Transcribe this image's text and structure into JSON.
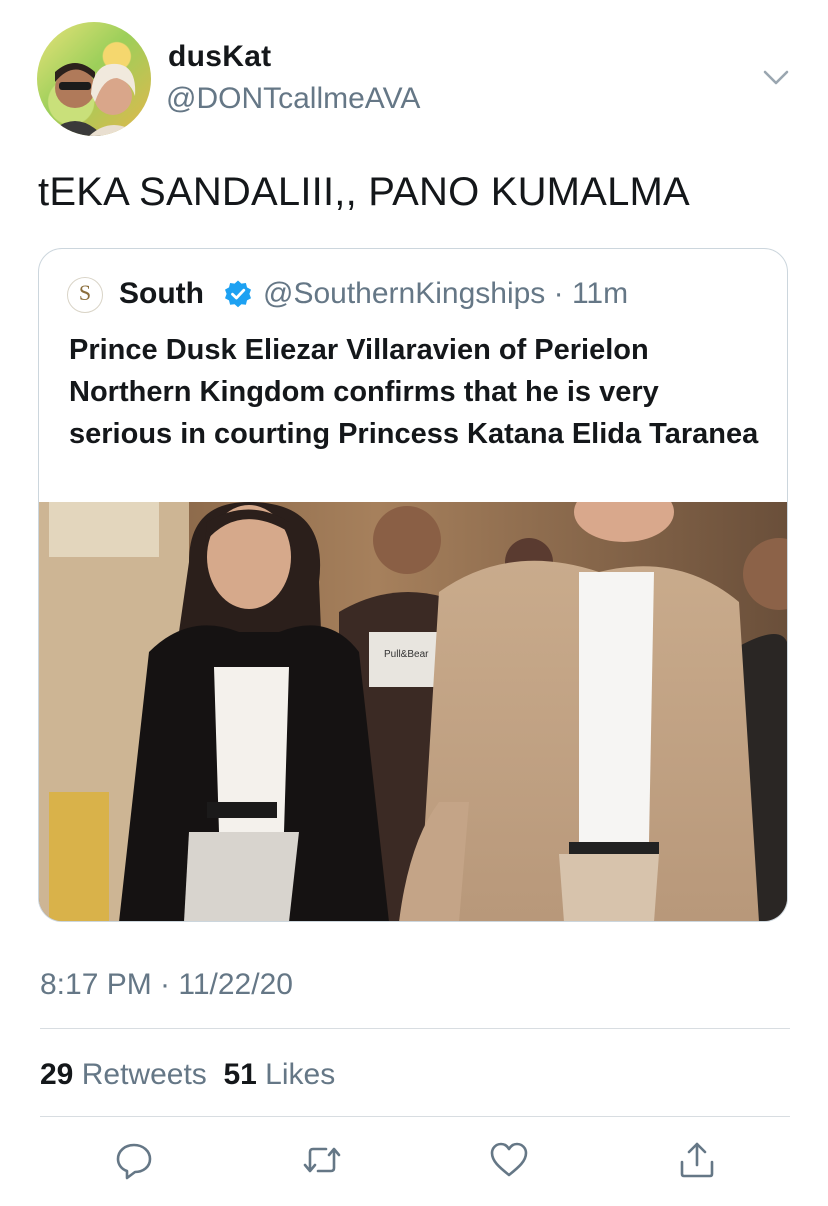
{
  "author": {
    "name": "dusKat",
    "handle": "@DONTcallmeAVA"
  },
  "tweet": {
    "text": "tEKA SANDALIII,, PANO KUMALMA",
    "timestamp": "8:17 PM · 11/22/20"
  },
  "quoted_tweet": {
    "logo_letter": "S",
    "logo_caption": "SOUTH",
    "name": "South",
    "handle_time": "@SouthernKingships · 11m",
    "text": "Prince Dusk Eliezar Villaravien of Perielon Northern Kingdom confirms that he is very serious in courting Princess Katana Elida Taranea",
    "photo_shirt_text": "Pull&Bear"
  },
  "stats": {
    "retweets_count": "29",
    "retweets_label": "Retweets",
    "likes_count": "51",
    "likes_label": "Likes"
  },
  "icons": {
    "menu": "chevron-down-icon",
    "verified": "verified-badge-icon",
    "reply": "reply-icon",
    "retweet": "retweet-icon",
    "like": "heart-icon",
    "share": "share-icon"
  },
  "colors": {
    "primary_text": "#14171a",
    "secondary_text": "#657786",
    "verified_blue": "#1da1f2",
    "divider": "#d8dde1"
  }
}
